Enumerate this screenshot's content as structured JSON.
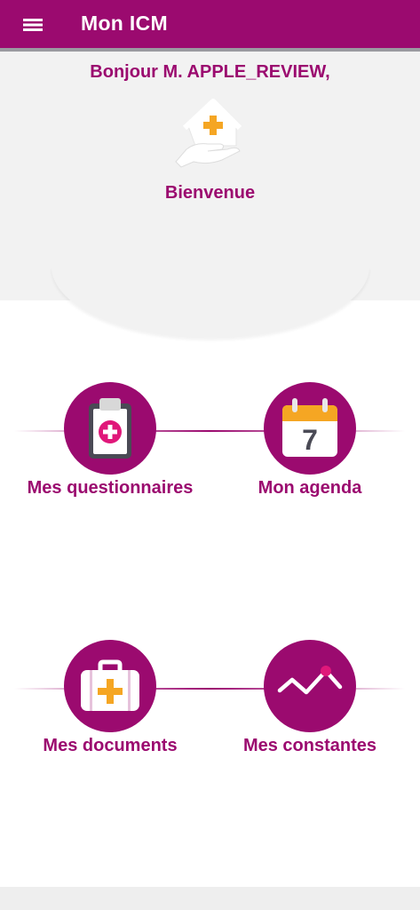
{
  "app_bar": {
    "title": "Mon ICM",
    "menu_icon": "hamburger-menu-icon",
    "background": "#9b0a6f"
  },
  "hero": {
    "greeting": "Bonjour M. APPLE_REVIEW,",
    "icon": "house-hand-medical-icon",
    "welcome": "Bienvenue"
  },
  "tiles": [
    {
      "label": "Mes questionnaires",
      "icon": "clipboard-medical-icon"
    },
    {
      "label": "Mon agenda",
      "icon": "calendar-icon",
      "calendar_day": "7"
    },
    {
      "label": "Mes documents",
      "icon": "medical-briefcase-icon"
    },
    {
      "label": "Mes constantes",
      "icon": "vital-signs-chart-icon"
    }
  ],
  "colors": {
    "primary": "#9b0a6f",
    "accent_orange": "#f5a623",
    "accent_pink": "#e0187a",
    "hero_bg": "#f2f2f2"
  }
}
